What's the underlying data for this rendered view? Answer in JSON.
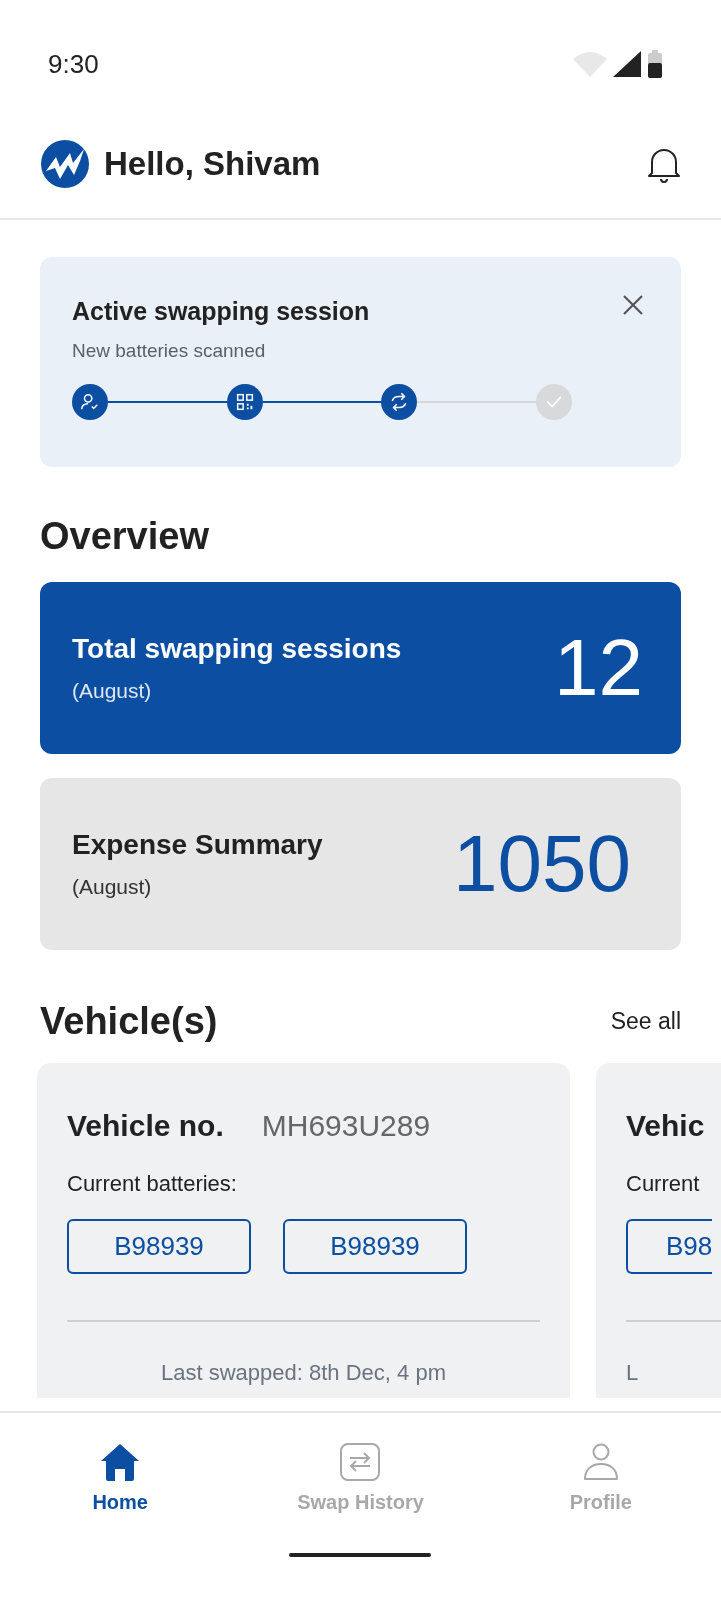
{
  "status_bar": {
    "time": "9:30"
  },
  "header": {
    "greeting": "Hello, Shivam"
  },
  "active_session": {
    "title": "Active swapping session",
    "subtitle": "New batteries scanned",
    "steps": [
      {
        "kind": "user",
        "done": true
      },
      {
        "kind": "qr",
        "done": true
      },
      {
        "kind": "swap",
        "done": true
      },
      {
        "kind": "check",
        "done": false
      }
    ]
  },
  "overview": {
    "title": "Overview",
    "cards": [
      {
        "kind": "primary",
        "label": "Total swapping sessions",
        "period": "(August)",
        "value": "12"
      },
      {
        "kind": "secondary",
        "label": "Expense Summary",
        "period": "(August)",
        "value": "1050"
      }
    ]
  },
  "vehicles": {
    "title": "Vehicle(s)",
    "see_all": "See all",
    "cards": [
      {
        "label": "Vehicle no.",
        "number": "MH693U289",
        "batteries_label": "Current batteries:",
        "batteries": [
          "B98939",
          "B98939"
        ],
        "last_swapped": "Last swapped: 8th Dec, 4 pm"
      },
      {
        "label": "Vehic",
        "batteries_label": "Current",
        "batteries": [
          "B98"
        ],
        "last_swapped": "L"
      }
    ]
  },
  "bottom_nav": [
    {
      "kind": "home",
      "label": "Home",
      "selected": true
    },
    {
      "kind": "swap",
      "label": "Swap History",
      "selected": false
    },
    {
      "kind": "profile",
      "label": "Profile",
      "selected": false
    }
  ]
}
